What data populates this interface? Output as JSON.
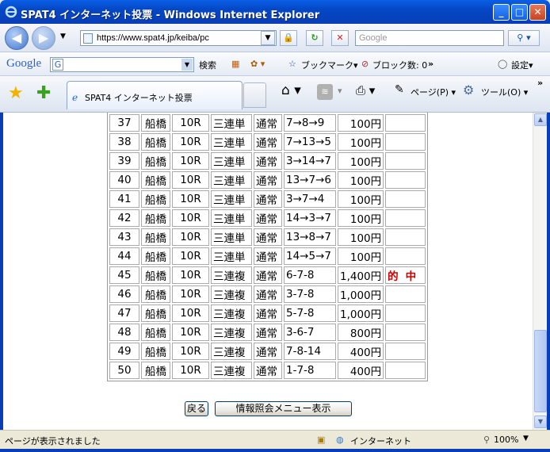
{
  "window": {
    "title": "SPAT4 インターネット投票 - Windows Internet Explorer"
  },
  "address": {
    "url": "https://www.spat4.jp/keiba/pc",
    "search_placeholder": "Google"
  },
  "google_bar": {
    "logo": "Google",
    "search": "検索",
    "bookmarks": "ブックマーク▾",
    "blocked": "ブロック数: 0",
    "more": "»",
    "settings": "設定▾"
  },
  "tab": {
    "label": "SPAT4 インターネット投票"
  },
  "tools": {
    "page": "ページ(P) ▾",
    "tools": "ツール(O) ▾",
    "more": "»"
  },
  "table": {
    "rows": [
      {
        "no": "37",
        "venue": "船橋",
        "race": "10R",
        "type": "三連単",
        "kind": "通常",
        "combo": "7→8→9",
        "amount": "100円",
        "hit": ""
      },
      {
        "no": "38",
        "venue": "船橋",
        "race": "10R",
        "type": "三連単",
        "kind": "通常",
        "combo": "7→13→5",
        "amount": "100円",
        "hit": ""
      },
      {
        "no": "39",
        "venue": "船橋",
        "race": "10R",
        "type": "三連単",
        "kind": "通常",
        "combo": "3→14→7",
        "amount": "100円",
        "hit": ""
      },
      {
        "no": "40",
        "venue": "船橋",
        "race": "10R",
        "type": "三連単",
        "kind": "通常",
        "combo": "13→7→6",
        "amount": "100円",
        "hit": ""
      },
      {
        "no": "41",
        "venue": "船橋",
        "race": "10R",
        "type": "三連単",
        "kind": "通常",
        "combo": "3→7→4",
        "amount": "100円",
        "hit": ""
      },
      {
        "no": "42",
        "venue": "船橋",
        "race": "10R",
        "type": "三連単",
        "kind": "通常",
        "combo": "14→3→7",
        "amount": "100円",
        "hit": ""
      },
      {
        "no": "43",
        "venue": "船橋",
        "race": "10R",
        "type": "三連単",
        "kind": "通常",
        "combo": "13→8→7",
        "amount": "100円",
        "hit": ""
      },
      {
        "no": "44",
        "venue": "船橋",
        "race": "10R",
        "type": "三連単",
        "kind": "通常",
        "combo": "14→5→7",
        "amount": "100円",
        "hit": ""
      },
      {
        "no": "45",
        "venue": "船橋",
        "race": "10R",
        "type": "三連複",
        "kind": "通常",
        "combo": "6-7-8",
        "amount": "1,400円",
        "hit": "的中"
      },
      {
        "no": "46",
        "venue": "船橋",
        "race": "10R",
        "type": "三連複",
        "kind": "通常",
        "combo": "3-7-8",
        "amount": "1,000円",
        "hit": ""
      },
      {
        "no": "47",
        "venue": "船橋",
        "race": "10R",
        "type": "三連複",
        "kind": "通常",
        "combo": "5-7-8",
        "amount": "1,000円",
        "hit": ""
      },
      {
        "no": "48",
        "venue": "船橋",
        "race": "10R",
        "type": "三連複",
        "kind": "通常",
        "combo": "3-6-7",
        "amount": "800円",
        "hit": ""
      },
      {
        "no": "49",
        "venue": "船橋",
        "race": "10R",
        "type": "三連複",
        "kind": "通常",
        "combo": "7-8-14",
        "amount": "400円",
        "hit": ""
      },
      {
        "no": "50",
        "venue": "船橋",
        "race": "10R",
        "type": "三連複",
        "kind": "通常",
        "combo": "1-7-8",
        "amount": "400円",
        "hit": ""
      }
    ]
  },
  "buttons": {
    "back": "戻る",
    "menu": "情報照会メニュー表示"
  },
  "status": {
    "text": "ページが表示されました",
    "zone": "インターネット",
    "zoom": "100%"
  },
  "colors": {
    "titlebar": "#0447c4",
    "hit": "#cc0000"
  }
}
